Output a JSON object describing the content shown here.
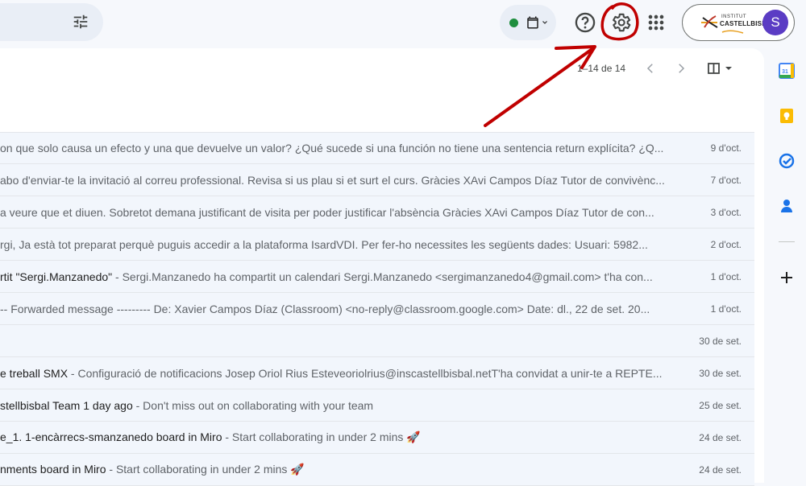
{
  "topbar": {
    "filter_icon": "tune-icon",
    "status_icons": [
      "green-status-dot",
      "calendar-icon",
      "chevron-down-icon"
    ],
    "help_icon": "help-icon",
    "settings_icon": "gear-icon",
    "apps_icon": "apps-grid-icon",
    "account": {
      "org_logo_line1": "INSTITUT",
      "org_logo_line2": "CASTELLBISBAL",
      "avatar_letter": "S"
    }
  },
  "pager": {
    "range_text": "1–14 de 14",
    "prev_icon": "chevron-left-icon",
    "next_icon": "chevron-right-icon",
    "split_icon": "split-pane-icon"
  },
  "emails": [
    {
      "subject": "",
      "snippet": "on que solo causa un efecto y una que devuelve un valor? ¿Qué sucede si una función no tiene una sentencia return explícita? ¿Q...",
      "date": "9 d'oct."
    },
    {
      "subject": "",
      "snippet": "abo d'enviar-te la invitació al correu professional. Revisa si us plau si et surt el curs. Gràcies XAvi Campos Díaz Tutor de convivènc...",
      "date": "7 d'oct."
    },
    {
      "subject": "",
      "snippet": "a veure que et diuen. Sobretot demana justificant de visita per poder justificar l'absència Gràcies XAvi Campos Díaz Tutor de con...",
      "date": "3 d'oct."
    },
    {
      "subject": "",
      "snippet": "rgi, Ja està tot preparat perquè puguis accedir a la plataforma IsardVDI. Per fer-ho necessites les següents dades: Usuari: 5982...",
      "date": "2 d'oct."
    },
    {
      "subject": "rtit \"Sergi.Manzanedo\"",
      "snippet": " - Sergi.Manzanedo ha compartit un calendari Sergi.Manzanedo <sergimanzanedo4@gmail.com> t'ha con...",
      "date": "1 d'oct."
    },
    {
      "subject": "",
      "snippet": "-- Forwarded message --------- De: Xavier Campos Díaz (Classroom) <no-reply@classroom.google.com> Date: dl., 22 de set. 20...",
      "date": "1 d'oct."
    },
    {
      "subject": "",
      "snippet": "",
      "date": "30 de set."
    },
    {
      "subject": "e treball SMX",
      "snippet": " - Configuració de notificacions Josep Oriol Rius Esteveoriolrius@inscastellbisbal.netT'ha convidat a unir-te a REPTE...",
      "date": "30 de set."
    },
    {
      "subject": "stellbisbal Team 1 day ago",
      "snippet": " - Don't miss out on collaborating with your team",
      "date": "25 de set."
    },
    {
      "subject": "e_1. 1-encàrrecs-smanzanedo board in Miro",
      "snippet": " - Start collaborating in under 2 mins 🚀",
      "date": "24 de set."
    },
    {
      "subject": "nments board in Miro",
      "snippet": " - Start collaborating in under 2 mins 🚀",
      "date": "24 de set."
    }
  ],
  "side_panel": {
    "icons": [
      "calendar-app-icon",
      "keep-icon",
      "tasks-icon",
      "contacts-icon",
      "add-icon"
    ]
  },
  "annotation": {
    "circle_color": "#c00000",
    "arrow_color": "#c00000"
  }
}
